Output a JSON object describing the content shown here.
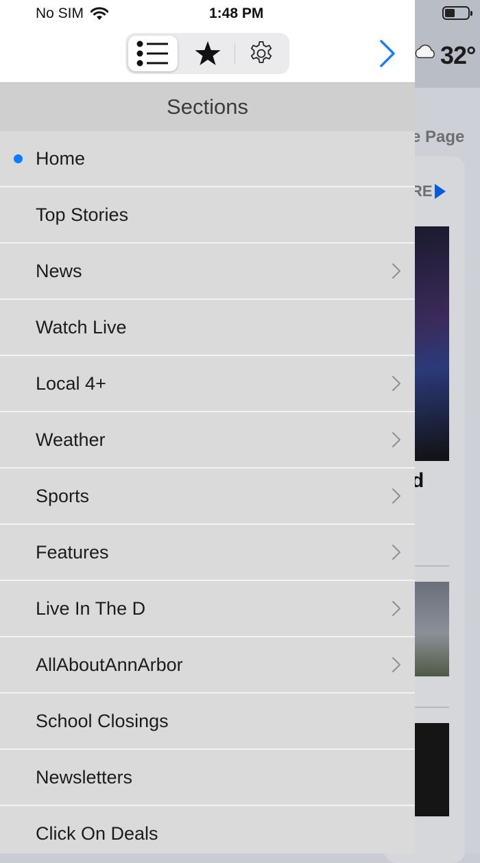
{
  "status_bar": {
    "carrier": "No SIM",
    "time": "1:48 PM"
  },
  "toolbar": {
    "segments": [
      {
        "icon": "list-icon",
        "selected": true
      },
      {
        "icon": "star-icon",
        "selected": false
      },
      {
        "icon": "gear-icon",
        "selected": false
      }
    ],
    "next_icon": "chevron-right-icon"
  },
  "sections": {
    "title": "Sections",
    "items": [
      {
        "label": "Home",
        "active": true,
        "has_children": false
      },
      {
        "label": "Top Stories",
        "active": false,
        "has_children": false
      },
      {
        "label": "News",
        "active": false,
        "has_children": true
      },
      {
        "label": "Watch Live",
        "active": false,
        "has_children": false
      },
      {
        "label": "Local 4+",
        "active": false,
        "has_children": true
      },
      {
        "label": "Weather",
        "active": false,
        "has_children": true
      },
      {
        "label": "Sports",
        "active": false,
        "has_children": true
      },
      {
        "label": "Features",
        "active": false,
        "has_children": true
      },
      {
        "label": "Live In The D",
        "active": false,
        "has_children": true
      },
      {
        "label": "AllAboutAnnArbor",
        "active": false,
        "has_children": true
      },
      {
        "label": "School Closings",
        "active": false,
        "has_children": false
      },
      {
        "label": "Newsletters",
        "active": false,
        "has_children": false
      },
      {
        "label": "Click On Deals",
        "active": false,
        "has_children": false
      }
    ]
  },
  "background": {
    "temperature": "32°",
    "front_page_label": "e Page",
    "more_label": "RE",
    "headline_fragment": "d"
  },
  "colors": {
    "accent": "#0a7cff",
    "drawer_bg": "#dadadb",
    "header_bg": "#cfcfd0"
  }
}
